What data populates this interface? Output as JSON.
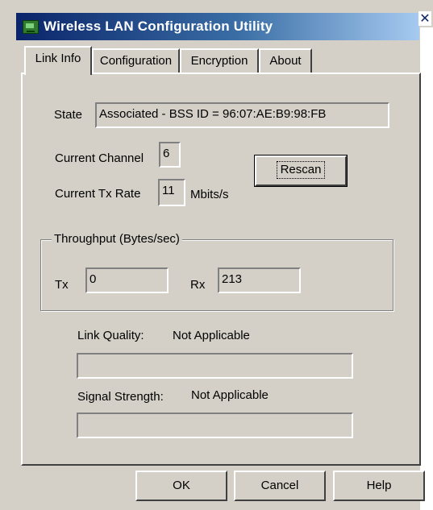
{
  "window": {
    "title": "Wireless LAN Configuration Utility",
    "close_glyph": "✕"
  },
  "tabs": [
    {
      "label": "Link Info",
      "active": true
    },
    {
      "label": "Configuration",
      "active": false
    },
    {
      "label": "Encryption",
      "active": false
    },
    {
      "label": "About",
      "active": false
    }
  ],
  "link_info": {
    "state_label": "State",
    "state_value": "Associated - BSS ID = 96:07:AE:B9:98:FB",
    "channel_label": "Current Channel",
    "channel_value": "6",
    "tx_rate_label": "Current Tx Rate",
    "tx_rate_value": "11",
    "tx_rate_unit": "Mbits/s",
    "rescan_label": "Rescan",
    "throughput": {
      "title": "Throughput (Bytes/sec)",
      "tx_label": "Tx",
      "tx_value": "0",
      "rx_label": "Rx",
      "rx_value": "213"
    },
    "link_quality_label": "Link Quality:",
    "link_quality_value": "Not Applicable",
    "link_quality_level": 0,
    "signal_strength_label": "Signal Strength:",
    "signal_strength_value": "Not Applicable",
    "signal_strength_level": 0
  },
  "buttons": {
    "ok": "OK",
    "cancel": "Cancel",
    "help": "Help"
  },
  "colors": {
    "titlebar_start": "#0a246a",
    "face": "#d4d0c8"
  }
}
